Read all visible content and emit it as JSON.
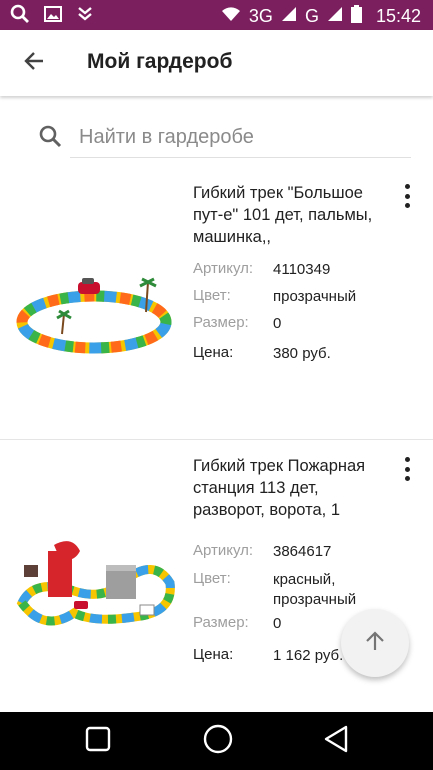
{
  "status_bar": {
    "network": "3G",
    "network2": "G",
    "time": "15:42",
    "icons": [
      "search-icon",
      "image-icon",
      "download-icon",
      "wifi-icon",
      "signal-icon",
      "signal-icon",
      "battery-icon"
    ]
  },
  "app_bar": {
    "title": "Мой гардероб",
    "back_icon": "arrow-back-icon"
  },
  "search": {
    "placeholder": "Найти в гардеробе"
  },
  "products": [
    {
      "title": "Гибкий трек \"Большое пут-е\" 101 дет, пальмы, машинка,,",
      "article_label": "Артикул:",
      "article": "4110349",
      "color_label": "Цвет:",
      "color": "прозрачный",
      "size_label": "Размер:",
      "size": "0",
      "price_label": "Цена:",
      "price": "380 руб."
    },
    {
      "title": "Гибкий трек Пожарная станция 113 дет, разворот, ворота,  1",
      "article_label": "Артикул:",
      "article": "3864617",
      "color_label": "Цвет:",
      "color": "красный, прозрачный",
      "size_label": "Размер:",
      "size": "0",
      "price_label": "Цена:",
      "price": "1 162 руб."
    }
  ],
  "colors": {
    "status_bar": "#7b1f5e",
    "nav_bar": "#000000"
  }
}
